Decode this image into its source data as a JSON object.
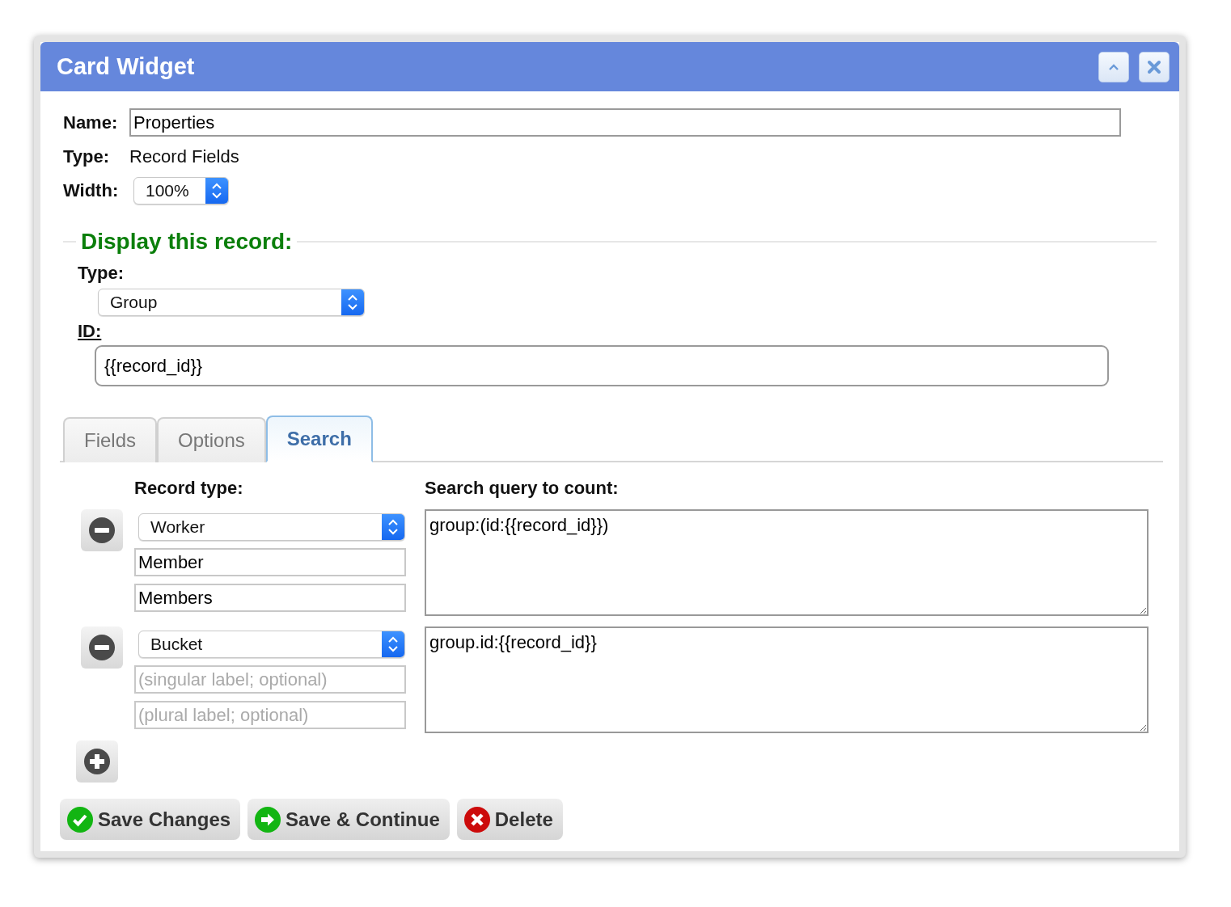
{
  "window": {
    "title": "Card Widget"
  },
  "title_buttons": [
    {
      "kind": "collapse"
    },
    {
      "kind": "close"
    }
  ],
  "fields": {
    "name": {
      "label": "Name:",
      "value": "Properties"
    },
    "type": {
      "label": "Type:",
      "value": "Record Fields"
    },
    "width": {
      "label": "Width:",
      "value": "100%"
    }
  },
  "display_record": {
    "legend": "Display this record:",
    "type_label": "Type:",
    "type_value": "Group",
    "id_label": "ID:",
    "id_value": "{{record_id}}"
  },
  "tabs": [
    {
      "label": "Fields",
      "selected": false
    },
    {
      "label": "Options",
      "selected": false
    },
    {
      "label": "Search",
      "selected": true
    }
  ],
  "search": {
    "record_type_heading": "Record type:",
    "query_heading": "Search query to count:",
    "rows": [
      {
        "record_type": "Worker",
        "singular": {
          "value": "Member"
        },
        "plural": {
          "value": "Members"
        },
        "query": "group:(id:{{record_id}})"
      },
      {
        "record_type": "Bucket",
        "singular": {
          "placeholder": "(singular label; optional)"
        },
        "plural": {
          "placeholder": "(plural label; optional)"
        },
        "query": "group.id:{{record_id}}"
      }
    ]
  },
  "buttons": [
    {
      "label": "Save Changes",
      "kind": "save"
    },
    {
      "label": "Save & Continue",
      "kind": "continue"
    },
    {
      "label": "Delete",
      "kind": "delete"
    }
  ]
}
